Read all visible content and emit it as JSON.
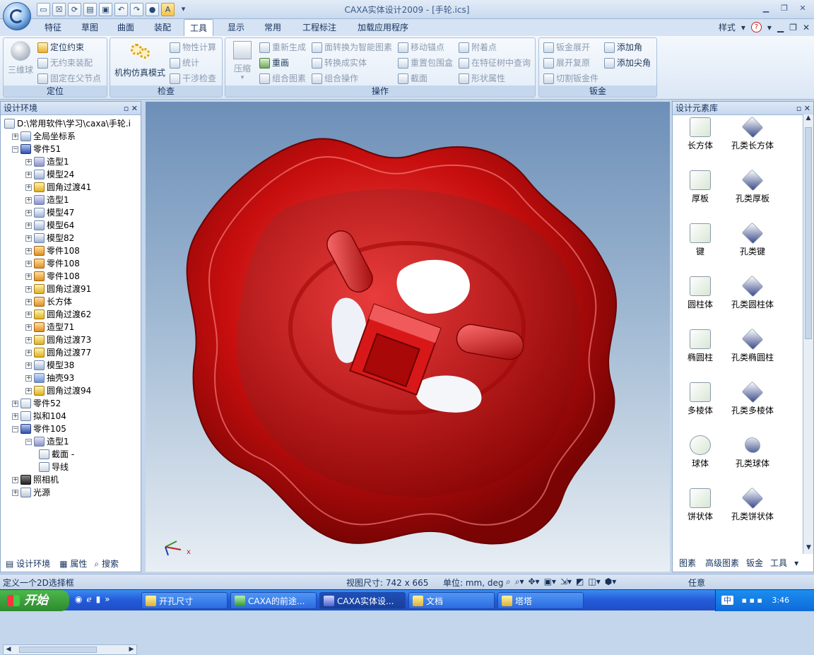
{
  "app": {
    "title": "CAXA实体设计2009 - [手轮.ics]"
  },
  "qat": {
    "items": [
      "new",
      "open",
      "save",
      "undo",
      "redo",
      "pin"
    ],
    "active_label": "A"
  },
  "menu": {
    "tabs": [
      "特征",
      "草图",
      "曲面",
      "装配",
      "工具",
      "显示",
      "常用",
      "工程标注",
      "加载应用程序"
    ],
    "selected": "工具",
    "style_label": "样式"
  },
  "ribbon": {
    "groups": [
      {
        "label": "定位",
        "big": "三维球",
        "items": [
          "定位约束",
          "无约束装配",
          "固定在父节点"
        ]
      },
      {
        "label": "检查",
        "big": "机构仿真模式",
        "items": [
          "物性计算",
          "统计",
          "干涉检查"
        ]
      },
      {
        "label": "操作",
        "big": "压缩",
        "items": [
          "重新生成",
          "重画",
          "组合图素",
          "面转换为智能图素",
          "转换成实体",
          "组合操作",
          "移动锚点",
          "重置包围盒",
          "截面",
          "附着点",
          "在特征树中查询",
          "形状属性"
        ]
      },
      {
        "label": "钣金",
        "items": [
          "钣金展开",
          "展开复原",
          "切割钣金件",
          "添加角",
          "添加尖角"
        ]
      }
    ]
  },
  "left_panel": {
    "title": "设计环境",
    "tree": [
      {
        "label": "D:\\常用软件\\学习\\caxa\\手轮.i",
        "icon": "document-icon",
        "depth": 0
      },
      {
        "label": "全局坐标系",
        "icon": "coordinate-icon",
        "depth": 1
      },
      {
        "label": "零件51",
        "icon": "part-icon",
        "depth": 1
      },
      {
        "label": "造型1",
        "icon": "shape-icon",
        "depth": 2
      },
      {
        "label": "模型24",
        "icon": "model-icon",
        "depth": 2
      },
      {
        "label": "圆角过渡41",
        "icon": "fillet-icon",
        "depth": 2
      },
      {
        "label": "造型1",
        "icon": "shape-icon",
        "depth": 2
      },
      {
        "label": "模型47",
        "icon": "model-icon",
        "depth": 2
      },
      {
        "label": "模型64",
        "icon": "model-icon",
        "depth": 2
      },
      {
        "label": "模型82",
        "icon": "model-icon",
        "depth": 2
      },
      {
        "label": "零件108",
        "icon": "box-icon",
        "depth": 2
      },
      {
        "label": "零件108",
        "icon": "box-icon",
        "depth": 2
      },
      {
        "label": "零件108",
        "icon": "box-icon",
        "depth": 2
      },
      {
        "label": "圆角过渡91",
        "icon": "fillet-icon",
        "depth": 2
      },
      {
        "label": "长方体",
        "icon": "box-icon",
        "depth": 2
      },
      {
        "label": "圆角过渡62",
        "icon": "fillet-icon",
        "depth": 2
      },
      {
        "label": "造型71",
        "icon": "box-icon",
        "depth": 2
      },
      {
        "label": "圆角过渡73",
        "icon": "fillet-icon",
        "depth": 2
      },
      {
        "label": "圆角过渡77",
        "icon": "fillet-icon",
        "depth": 2
      },
      {
        "label": "模型38",
        "icon": "model-icon",
        "depth": 2
      },
      {
        "label": "抽壳93",
        "icon": "shell-icon",
        "depth": 2
      },
      {
        "label": "圆角过渡94",
        "icon": "fillet-icon",
        "depth": 2
      },
      {
        "label": "零件52",
        "icon": "sketch-icon",
        "depth": 1
      },
      {
        "label": "拟和104",
        "icon": "sketch-icon",
        "depth": 1
      },
      {
        "label": "零件105",
        "icon": "part-icon",
        "depth": 1
      },
      {
        "label": "造型1",
        "icon": "shape-icon",
        "depth": 2
      },
      {
        "label": "截面 -",
        "icon": "sketch-icon",
        "depth": 3
      },
      {
        "label": "导线",
        "icon": "sketch-icon",
        "depth": 3
      },
      {
        "label": "照相机",
        "icon": "camera-icon",
        "depth": 1
      },
      {
        "label": "光源",
        "icon": "light-icon",
        "depth": 1
      }
    ],
    "tabs": [
      "设计环境",
      "属性",
      "搜索"
    ]
  },
  "right_panel": {
    "title": "设计元素库",
    "items": [
      {
        "label": "长方体",
        "color": "#d8e6d4"
      },
      {
        "label": "孔类长方体",
        "color": "#3a4a8a"
      },
      {
        "label": "厚板",
        "color": "#d8e6d4"
      },
      {
        "label": "孔类厚板",
        "color": "#3a4a8a"
      },
      {
        "label": "键",
        "color": "#d8e6d4"
      },
      {
        "label": "孔类键",
        "color": "#3a4a8a"
      },
      {
        "label": "圆柱体",
        "color": "#d8e6d4"
      },
      {
        "label": "孔类圆柱体",
        "color": "#3a4a8a"
      },
      {
        "label": "椭圆柱",
        "color": "#d8e6d4"
      },
      {
        "label": "孔类椭圆柱",
        "color": "#3a4a8a"
      },
      {
        "label": "多棱体",
        "color": "#d8e6d4"
      },
      {
        "label": "孔类多棱体",
        "color": "#3a4a8a"
      },
      {
        "label": "球体",
        "color": "#d8e6d4"
      },
      {
        "label": "孔类球体",
        "color": "#3a4a8a"
      },
      {
        "label": "饼状体",
        "color": "#d8e6d4"
      },
      {
        "label": "孔类饼状体",
        "color": "#3a4a8a"
      }
    ],
    "tabs": [
      "图素",
      "高级图素",
      "钣金",
      "工具"
    ]
  },
  "viewport": {
    "model_color": "#d01010",
    "axis_label": "x"
  },
  "status": {
    "prompt": "定义一个2D选择框",
    "view_size": "视图尺寸: 742 x 665",
    "units": "单位: mm, deg",
    "select": "任意"
  },
  "taskbar": {
    "start": "开始",
    "buttons": [
      "开孔尺寸",
      "CAXA的前途...",
      "CAXA实体设...",
      "文档",
      "塔塔"
    ],
    "active": 2,
    "tray_text": "中",
    "clock": "3:46"
  }
}
